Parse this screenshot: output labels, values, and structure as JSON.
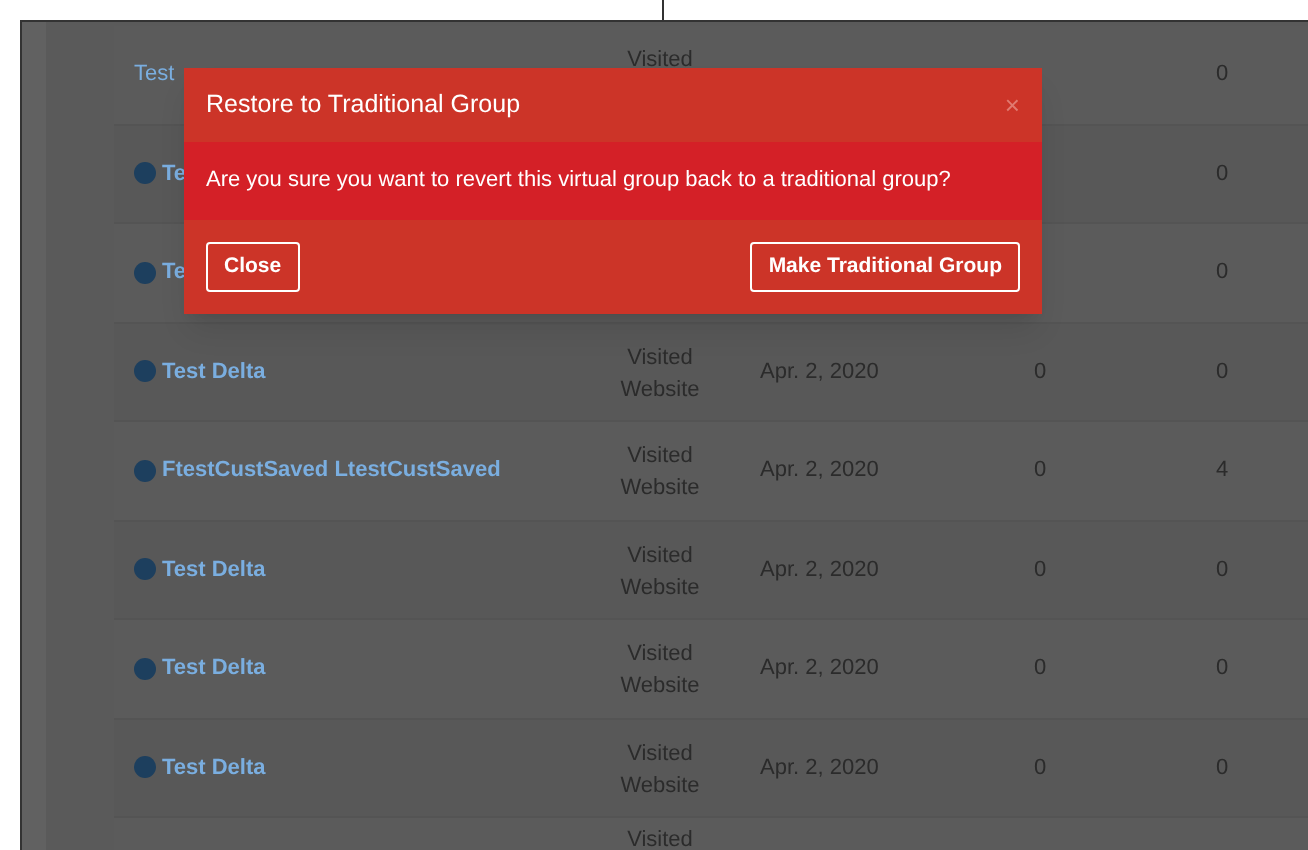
{
  "table": {
    "rows": [
      {
        "kind": "plain",
        "name": "Test",
        "column_2": "Visited",
        "column_5": "0"
      },
      {
        "kind": "link",
        "name": "Te",
        "column_5": "0"
      },
      {
        "kind": "link",
        "name": "Te",
        "column_5": "0"
      },
      {
        "kind": "link",
        "name": "Test Delta",
        "column_2": "Visited Website",
        "date": "Apr. 2, 2020",
        "column_4": "0",
        "column_5": "0"
      },
      {
        "kind": "link",
        "name": "FtestCustSaved LtestCustSaved",
        "column_2": "Visited Website",
        "date": "Apr. 2, 2020",
        "column_4": "0",
        "column_5": "4"
      },
      {
        "kind": "link",
        "name": "Test Delta",
        "column_2": "Visited Website",
        "date": "Apr. 2, 2020",
        "column_4": "0",
        "column_5": "0"
      },
      {
        "kind": "link",
        "name": "Test Delta",
        "column_2": "Visited Website",
        "date": "Apr. 2, 2020",
        "column_4": "0",
        "column_5": "0"
      },
      {
        "kind": "link",
        "name": "Test Delta",
        "column_2": "Visited Website",
        "date": "Apr. 2, 2020",
        "column_4": "0",
        "column_5": "0"
      },
      {
        "kind": "partial",
        "column_2": "Visited"
      }
    ]
  },
  "dialog": {
    "title": "Restore to Traditional Group",
    "close_glyph": "×",
    "message": "Are you sure you want to revert this virtual group back to a traditional group?",
    "buttons": [
      "Close",
      "Make Traditional Group"
    ]
  }
}
